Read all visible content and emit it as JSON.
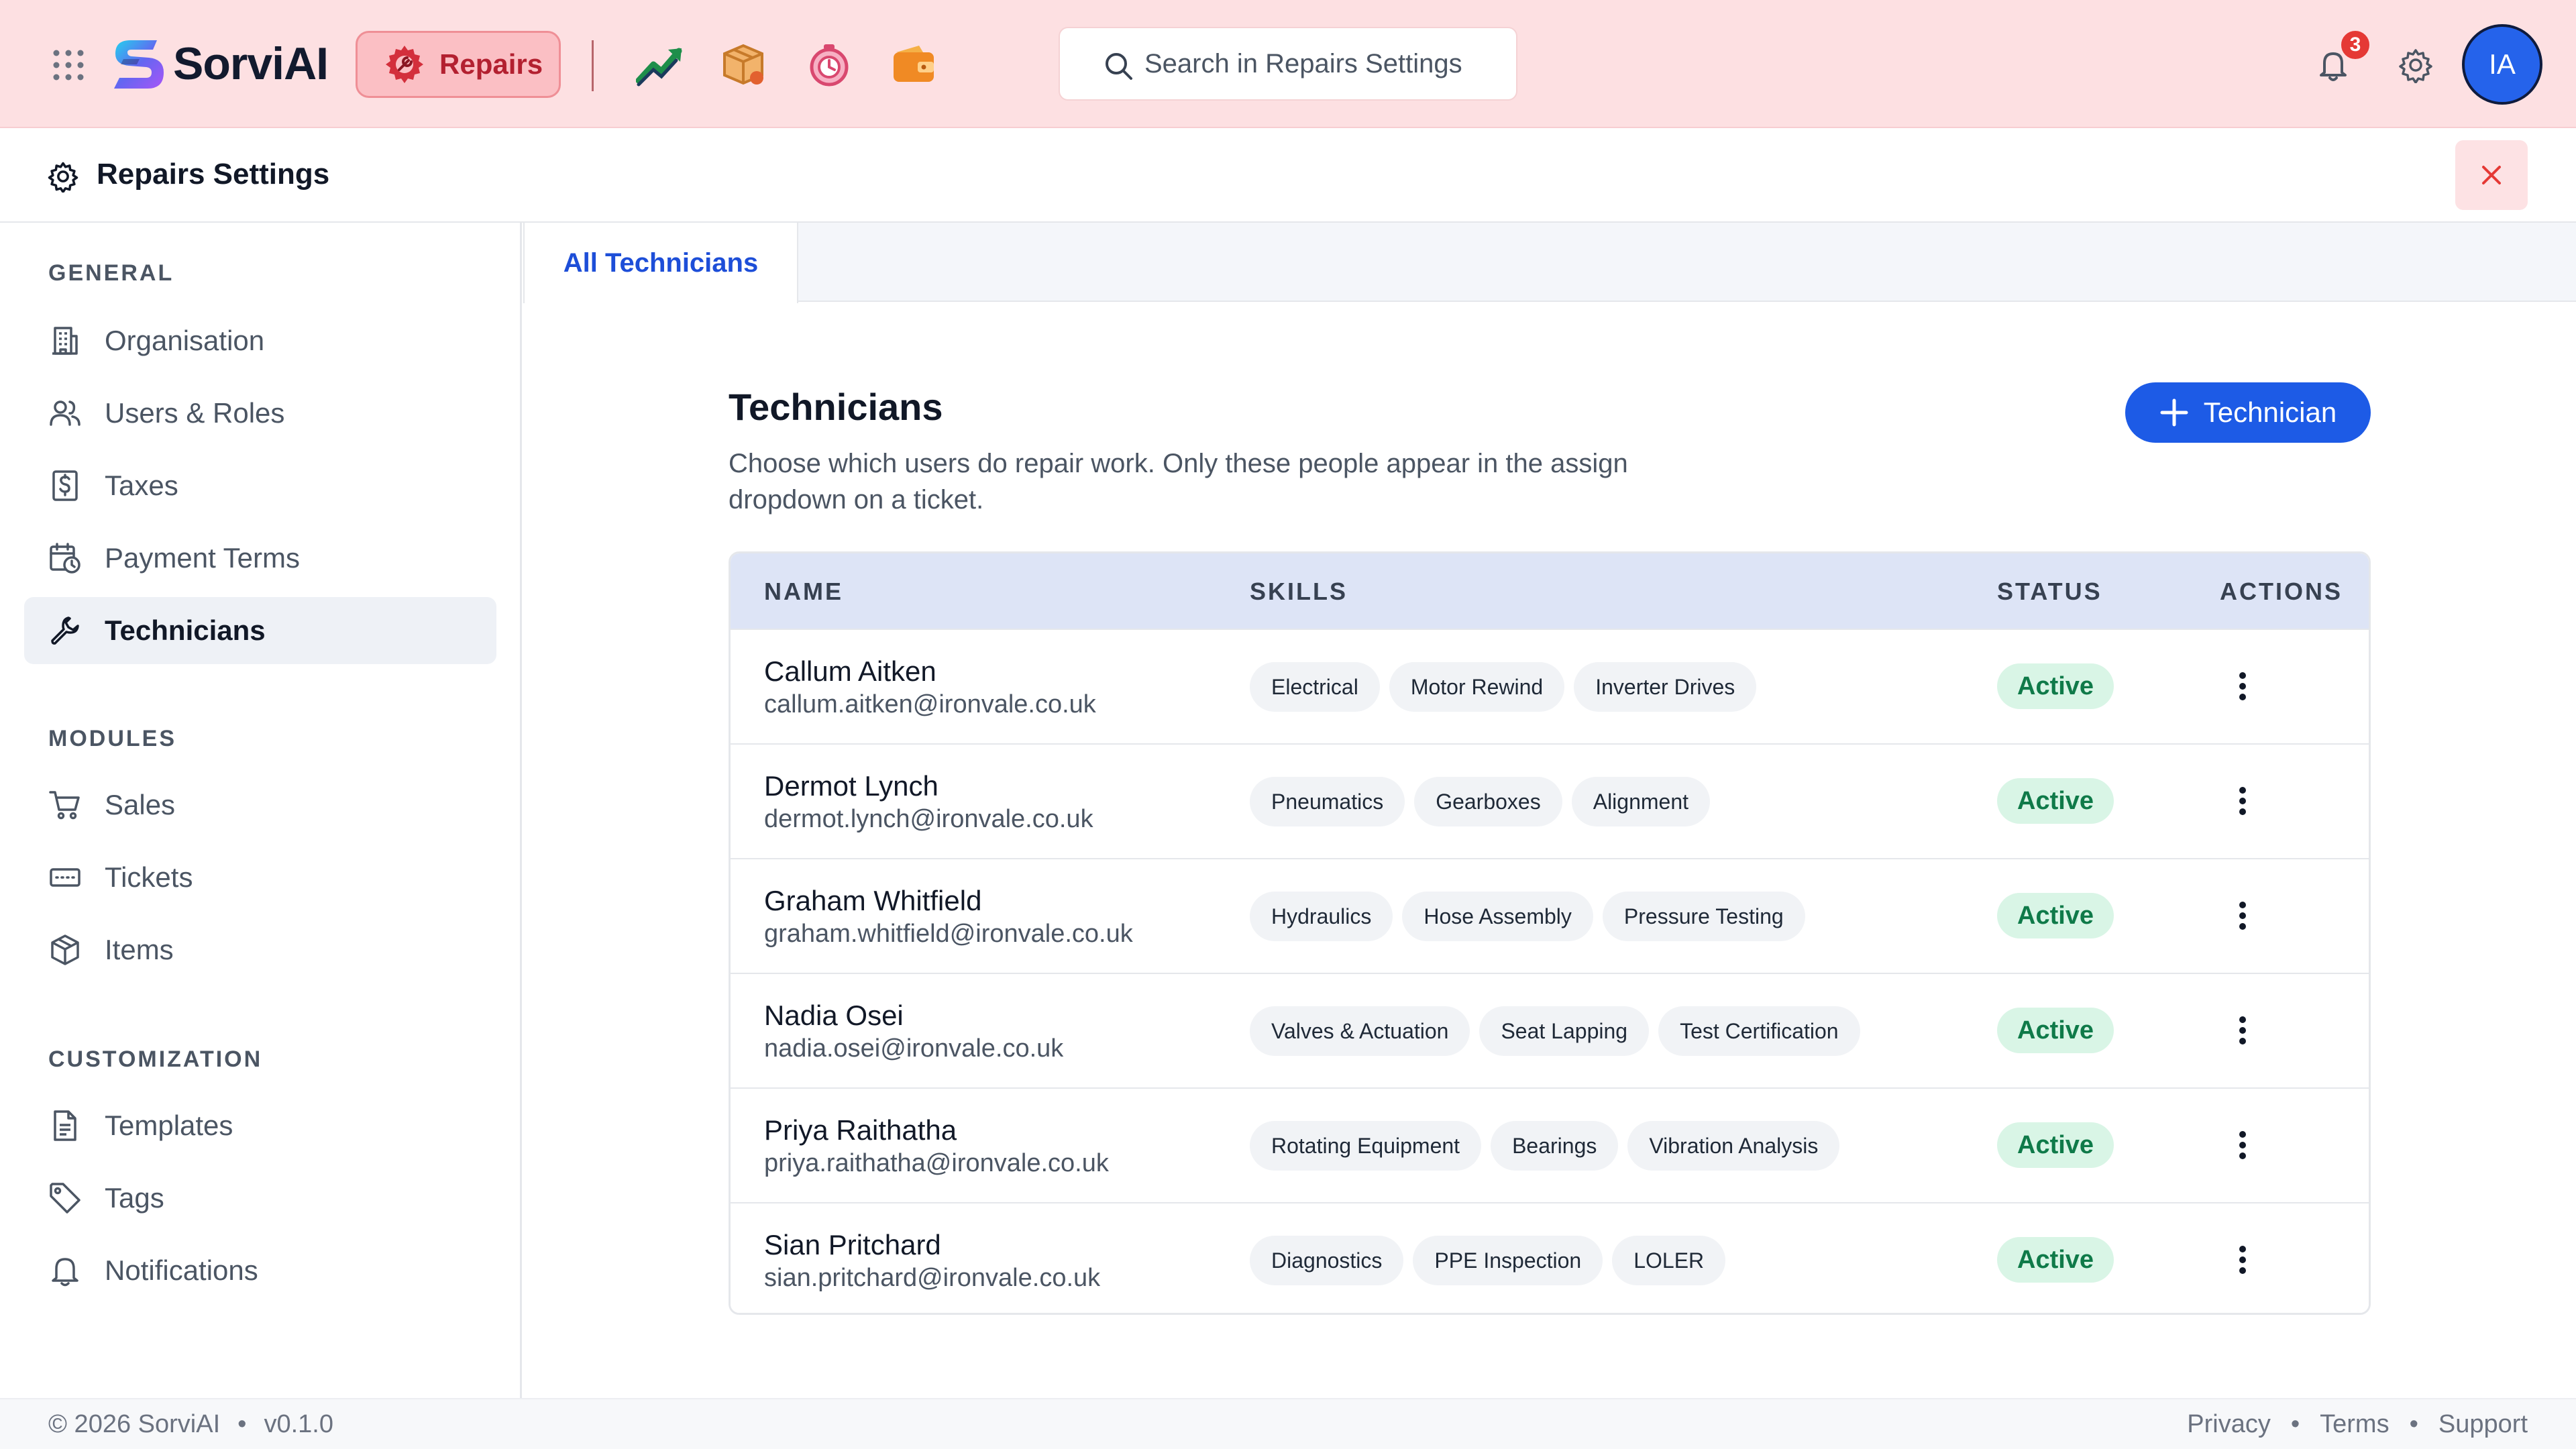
{
  "topbar": {
    "brand": "SorviAI",
    "active_module": "Repairs",
    "search_placeholder": "Search in Repairs Settings",
    "notification_count": "3",
    "avatar_initials": "IA",
    "module_icons": [
      "trend-chart-icon",
      "box-icon",
      "timer-icon",
      "wallet-icon"
    ]
  },
  "header": {
    "title": "Repairs Settings"
  },
  "sidebar": {
    "sections": [
      {
        "label": "GENERAL",
        "items": [
          {
            "label": "Organisation",
            "icon": "building-icon"
          },
          {
            "label": "Users & Roles",
            "icon": "users-icon"
          },
          {
            "label": "Taxes",
            "icon": "tax-icon"
          },
          {
            "label": "Payment Terms",
            "icon": "calendar-clock-icon"
          },
          {
            "label": "Technicians",
            "icon": "wrench-icon",
            "active": true
          }
        ]
      },
      {
        "label": "MODULES",
        "items": [
          {
            "label": "Sales",
            "icon": "cart-icon"
          },
          {
            "label": "Tickets",
            "icon": "ticket-icon"
          },
          {
            "label": "Items",
            "icon": "package-icon"
          }
        ]
      },
      {
        "label": "CUSTOMIZATION",
        "items": [
          {
            "label": "Templates",
            "icon": "document-icon"
          },
          {
            "label": "Tags",
            "icon": "tag-icon"
          },
          {
            "label": "Notifications",
            "icon": "bell-icon"
          }
        ]
      }
    ]
  },
  "tabs": [
    {
      "label": "All Technicians",
      "active": true
    }
  ],
  "main": {
    "title": "Technicians",
    "description": "Choose which users do repair work. Only these people appear in the assign dropdown on a ticket.",
    "add_button": "Technician"
  },
  "table": {
    "columns": [
      "NAME",
      "SKILLS",
      "STATUS",
      "ACTIONS"
    ],
    "rows": [
      {
        "name": "Callum Aitken",
        "email": "callum.aitken@ironvale.co.uk",
        "skills": [
          "Electrical",
          "Motor Rewind",
          "Inverter Drives"
        ],
        "status": "Active"
      },
      {
        "name": "Dermot Lynch",
        "email": "dermot.lynch@ironvale.co.uk",
        "skills": [
          "Pneumatics",
          "Gearboxes",
          "Alignment"
        ],
        "status": "Active"
      },
      {
        "name": "Graham Whitfield",
        "email": "graham.whitfield@ironvale.co.uk",
        "skills": [
          "Hydraulics",
          "Hose Assembly",
          "Pressure Testing"
        ],
        "status": "Active"
      },
      {
        "name": "Nadia Osei",
        "email": "nadia.osei@ironvale.co.uk",
        "skills": [
          "Valves & Actuation",
          "Seat Lapping",
          "Test Certification"
        ],
        "status": "Active"
      },
      {
        "name": "Priya Raithatha",
        "email": "priya.raithatha@ironvale.co.uk",
        "skills": [
          "Rotating Equipment",
          "Bearings",
          "Vibration Analysis"
        ],
        "status": "Active"
      },
      {
        "name": "Sian Pritchard",
        "email": "sian.pritchard@ironvale.co.uk",
        "skills": [
          "Diagnostics",
          "PPE Inspection",
          "LOLER"
        ],
        "status": "Active"
      }
    ]
  },
  "footer": {
    "copyright": "© 2026 SorviAI",
    "version": "v0.1.0",
    "links": [
      "Privacy",
      "Terms",
      "Support"
    ],
    "separator": "•"
  },
  "colors": {
    "topbar_bg": "#fde0e2",
    "accent_blue": "#1d5be6",
    "status_active_bg": "#d9f5e6",
    "status_active_text": "#0f7a49",
    "repairs_pill": "#fbbfc4"
  }
}
